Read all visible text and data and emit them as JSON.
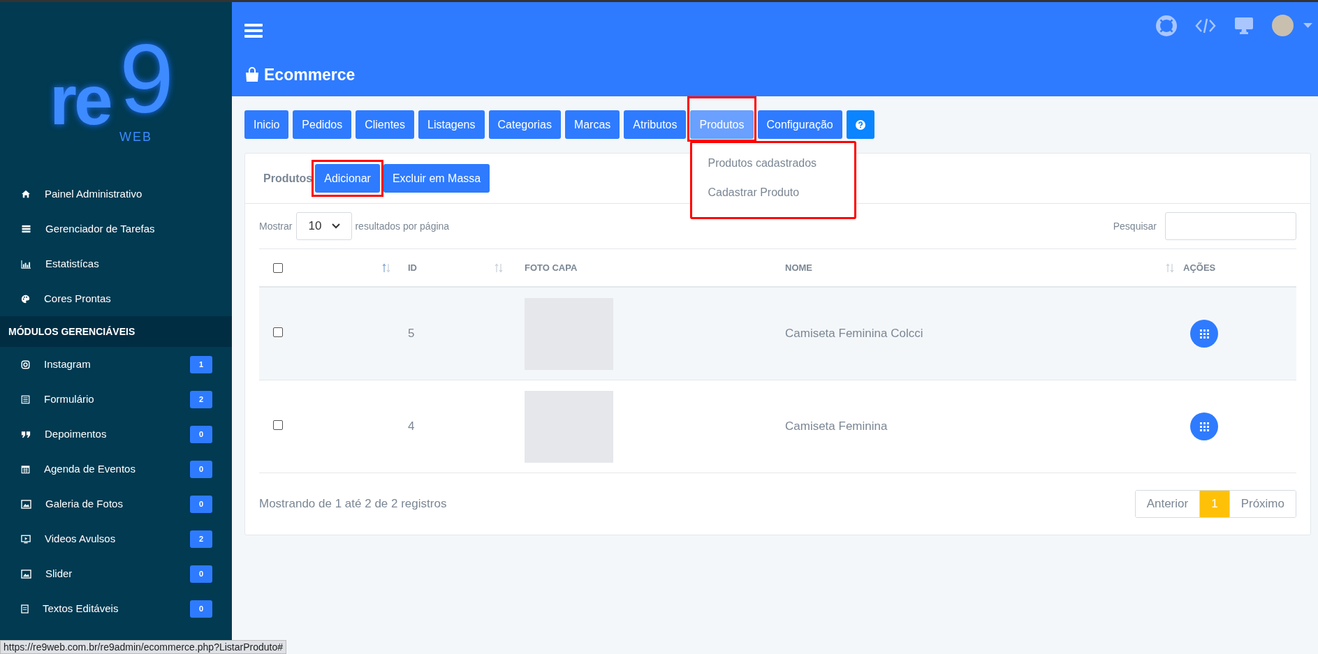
{
  "sidebar": {
    "logo": {
      "letters": "re",
      "digit": "9",
      "sub": "WEB"
    },
    "items": [
      {
        "label": "Painel Administrativo"
      },
      {
        "label": "Gerenciador de Tarefas"
      },
      {
        "label": "Estatistícas"
      },
      {
        "label": "Cores Prontas"
      }
    ],
    "section_title": "MÓDULOS GERENCIÁVEIS",
    "modules": [
      {
        "label": "Instagram",
        "count": "1"
      },
      {
        "label": "Formulário",
        "count": "2"
      },
      {
        "label": "Depoimentos",
        "count": "0"
      },
      {
        "label": "Agenda de Eventos",
        "count": "0"
      },
      {
        "label": "Galeria de Fotos",
        "count": "0"
      },
      {
        "label": "Videos Avulsos",
        "count": "2"
      },
      {
        "label": "Slider",
        "count": "0"
      },
      {
        "label": "Textos Editáveis",
        "count": "0"
      }
    ]
  },
  "header": {
    "title": "Ecommerce"
  },
  "tabs": [
    {
      "label": "Inicio",
      "selected": false,
      "highlighted": false
    },
    {
      "label": "Pedidos",
      "selected": false,
      "highlighted": false
    },
    {
      "label": "Clientes",
      "selected": false,
      "highlighted": false
    },
    {
      "label": "Listagens",
      "selected": false,
      "highlighted": false
    },
    {
      "label": "Categorias",
      "selected": false,
      "highlighted": false
    },
    {
      "label": "Marcas",
      "selected": false,
      "highlighted": false
    },
    {
      "label": "Atributos",
      "selected": false,
      "highlighted": false
    },
    {
      "label": "Produtos",
      "selected": true,
      "highlighted": true
    },
    {
      "label": "Configuração",
      "selected": false,
      "highlighted": false
    }
  ],
  "dropdown": {
    "items": [
      "Produtos cadastrados",
      "Cadastrar Produto"
    ],
    "highlighted": true
  },
  "panel": {
    "title": "Produtos",
    "buttons": [
      {
        "label": "Adicionar",
        "highlighted": true
      },
      {
        "label": "Excluir em Massa",
        "highlighted": false
      }
    ],
    "show_label": "Mostrar",
    "page_size": "10",
    "per_page_label": "resultados por página",
    "search_label": "Pesquisar",
    "columns": [
      "ID",
      "FOTO CAPA",
      "NOME",
      "AÇÕES"
    ],
    "header_checked": false,
    "rows": [
      {
        "checked": false,
        "id": "5",
        "name": "Camiseta Feminina Colcci"
      },
      {
        "checked": false,
        "id": "4",
        "name": "Camiseta Feminina"
      }
    ],
    "info": "Mostrando de 1 até 2 de 2 registros",
    "pagination": [
      {
        "label": "Anterior",
        "selected": false
      },
      {
        "label": "1",
        "selected": true
      },
      {
        "label": "Próximo",
        "selected": false
      }
    ]
  },
  "status_bar": {
    "url": "https://re9web.com.br/re9admin/ecommerce.php?ListarProduto#"
  }
}
